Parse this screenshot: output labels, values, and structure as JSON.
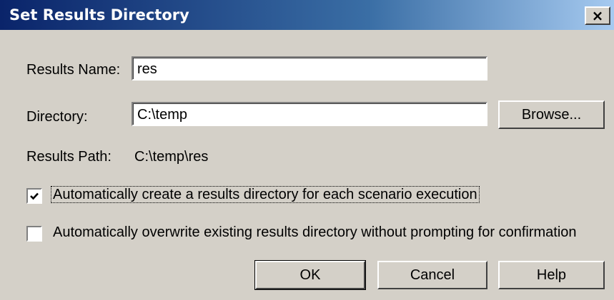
{
  "window": {
    "title": "Set Results Directory",
    "close_label": "×"
  },
  "form": {
    "results_name_label": "Results Name:",
    "results_name_value": "res",
    "directory_label": "Directory:",
    "directory_value": "C:\\temp",
    "browse_label": "Browse...",
    "results_path_label": "Results Path:",
    "results_path_value": "C:\\temp\\res"
  },
  "options": [
    {
      "label": "Automatically create a results directory for each scenario execution",
      "checked": true
    },
    {
      "label": "Automatically overwrite existing results directory without prompting for confirmation",
      "checked": false
    }
  ],
  "buttons": {
    "ok": "OK",
    "cancel": "Cancel",
    "help": "Help"
  },
  "icons": {
    "close": "close-icon",
    "checkmark": "checkmark-icon"
  },
  "colors": {
    "titlebar_start": "#0a246a",
    "titlebar_end": "#a6caf0",
    "dialog_bg": "#d4d0c8"
  }
}
